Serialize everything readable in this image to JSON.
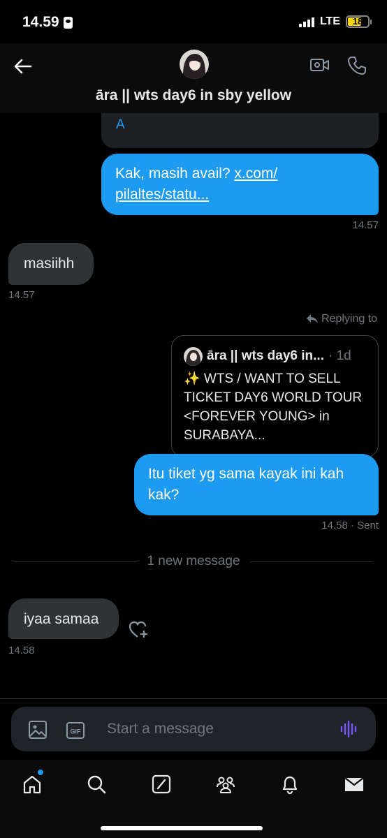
{
  "status_bar": {
    "time": "14.59",
    "network": "LTE",
    "battery": "18"
  },
  "header": {
    "title": "āra || wts day6 in sby yellow"
  },
  "conversation": {
    "previous_card_text": "A",
    "message_1": {
      "text_before": "Kak, masih avail? ",
      "link_line1": "x.com/",
      "link_line2": "pilaltes/statu...",
      "timestamp": "14.57"
    },
    "message_2": {
      "text": "masiihh",
      "timestamp": "14.57"
    },
    "reply": {
      "label": "Replying to",
      "quote_name": "āra || wts day6 in...",
      "quote_time": "· 1d",
      "quote_text": "✨ WTS / WANT TO SELL TICKET DAY6 WORLD TOUR <FOREVER YOUNG> in SURABAYA..."
    },
    "message_3": {
      "text": "Itu tiket yg sama kayak ini kah kak?",
      "timestamp": "14.58 · Sent"
    },
    "divider": "1 new message",
    "message_4": {
      "text": "iyaa samaa",
      "timestamp": "14.58"
    }
  },
  "composer": {
    "placeholder": "Start a message",
    "gif_label": "GIF"
  },
  "nav": [
    "home",
    "search",
    "grok",
    "communities",
    "notifications",
    "messages"
  ],
  "colors": {
    "accent": "#1d9bf0",
    "incoming_bubble": "#2f3336",
    "secondary_text": "#71767b",
    "voice_icon": "#7856ff"
  }
}
